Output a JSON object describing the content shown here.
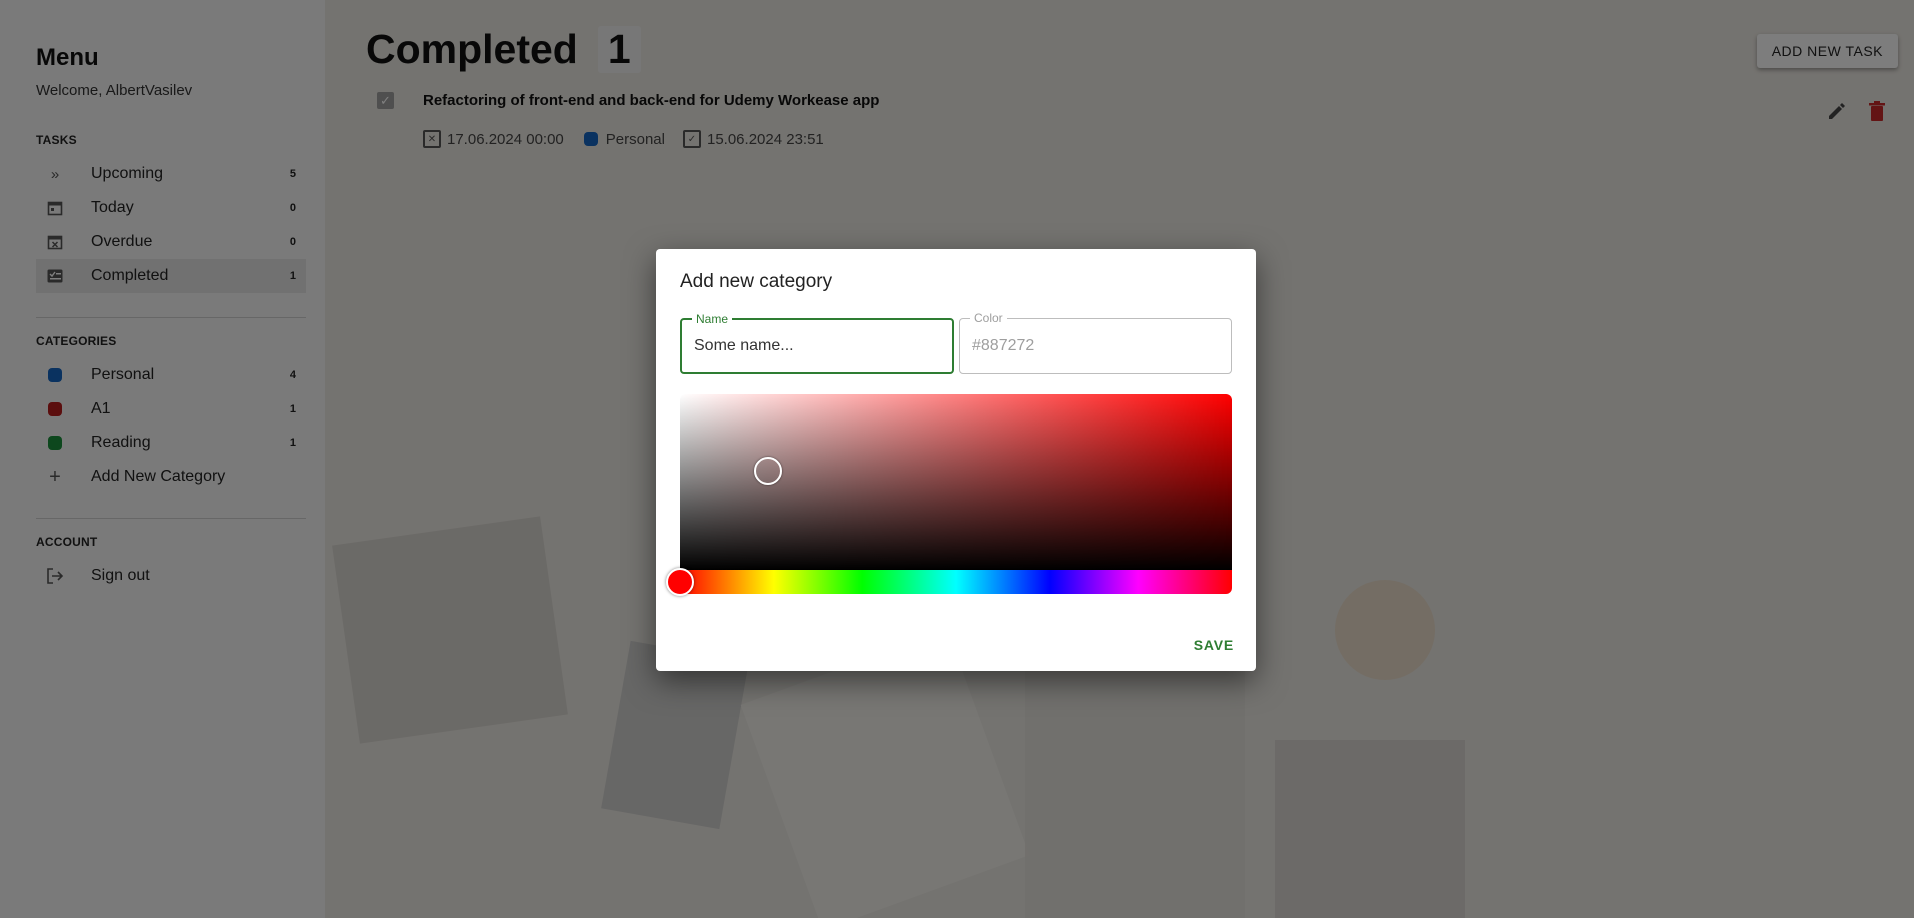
{
  "sidebar": {
    "title": "Menu",
    "welcome": "Welcome, AlbertVasilev",
    "tasks_header": "TASKS",
    "tasks": [
      {
        "label": "Upcoming",
        "count": "5",
        "icon": "double-chevron-right-icon"
      },
      {
        "label": "Today",
        "count": "0",
        "icon": "calendar-today-icon"
      },
      {
        "label": "Overdue",
        "count": "0",
        "icon": "calendar-x-icon"
      },
      {
        "label": "Completed",
        "count": "1",
        "icon": "checklist-icon"
      }
    ],
    "categories_header": "CATEGORIES",
    "categories": [
      {
        "label": "Personal",
        "count": "4",
        "color": "#1565c0"
      },
      {
        "label": "A1",
        "count": "1",
        "color": "#b71c1c"
      },
      {
        "label": "Reading",
        "count": "1",
        "color": "#1b8f3a"
      }
    ],
    "add_category": "Add New Category",
    "account_header": "ACCOUNT",
    "sign_out": "Sign out"
  },
  "main": {
    "title": "Completed",
    "count": "1",
    "add_task": "ADD NEW TASK",
    "task": {
      "title": "Refactoring of front-end and back-end for Udemy Workease app",
      "due": "17.06.2024 00:00",
      "category": "Personal",
      "category_color": "#1565c0",
      "completed": "15.06.2024 23:51"
    }
  },
  "dialog": {
    "title": "Add new category",
    "name_label": "Name",
    "name_value": "Some name...",
    "color_label": "Color",
    "color_placeholder": "#887272",
    "save": "SAVE",
    "hue_color": "#ff0000",
    "accent": "#2e7d32"
  }
}
